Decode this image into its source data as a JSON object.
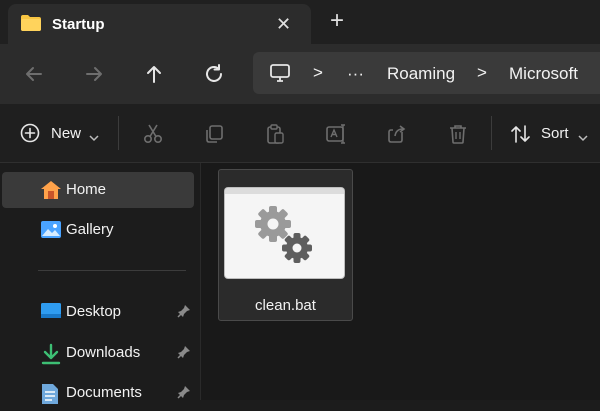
{
  "window": {
    "tab_title": "Startup",
    "tab_close": "✕",
    "new_tab": "+"
  },
  "navigation": {
    "breadcrumb": {
      "overflow": "···",
      "separator": ">",
      "items": [
        "Roaming",
        "Microsoft"
      ]
    }
  },
  "toolbar": {
    "new_label": "New",
    "sort_label": "Sort"
  },
  "sidebar": {
    "items": [
      {
        "label": "Home",
        "icon": "home-icon",
        "active": true
      },
      {
        "label": "Gallery",
        "icon": "gallery-icon"
      }
    ],
    "quick_access": [
      {
        "label": "Desktop",
        "icon": "desktop-icon",
        "pinned": true
      },
      {
        "label": "Downloads",
        "icon": "downloads-icon",
        "pinned": true
      },
      {
        "label": "Documents",
        "icon": "documents-icon",
        "pinned": true
      }
    ]
  },
  "files": [
    {
      "name": "clean.bat",
      "icon": "gears-icon"
    }
  ],
  "colors": {
    "background": "#1c1c1c",
    "folder": "#f8c542",
    "accent_blue": "#4aa3ff",
    "active_item": "#3a3a3a"
  }
}
